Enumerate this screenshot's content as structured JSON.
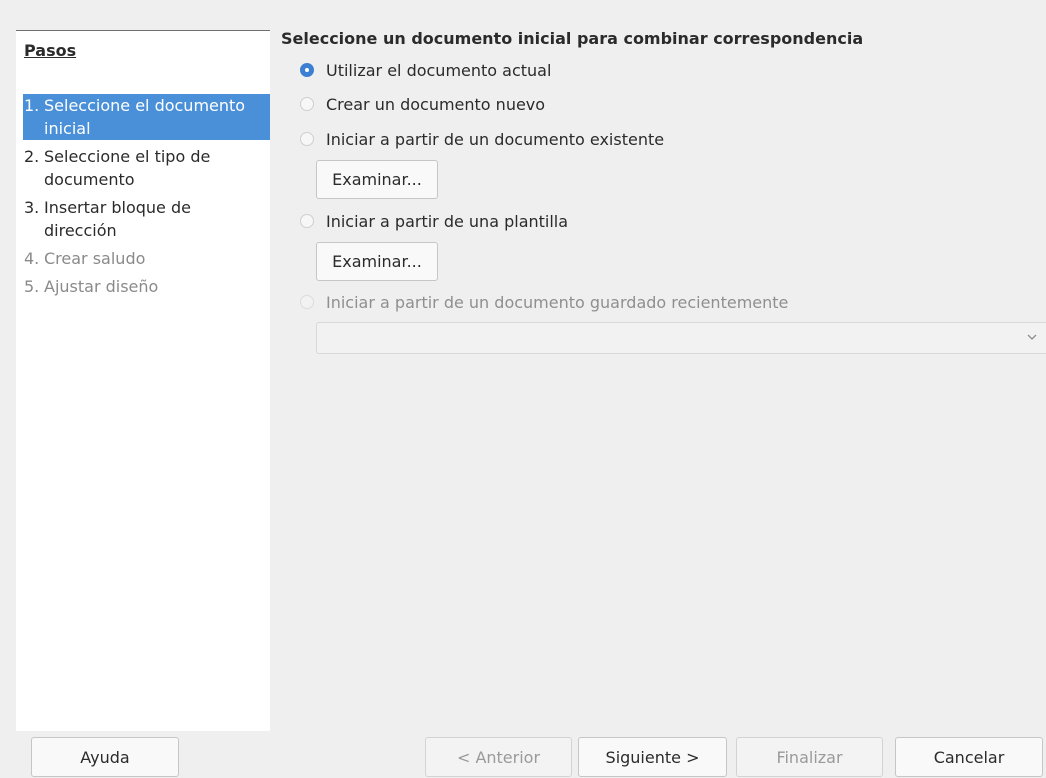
{
  "steps": {
    "title": "Pasos",
    "items": [
      {
        "num": "1.",
        "label": "Seleccione el documento inicial",
        "state": "active"
      },
      {
        "num": "2.",
        "label": "Seleccione el tipo de documento",
        "state": "enabled"
      },
      {
        "num": "3.",
        "label": "Insertar bloque de dirección",
        "state": "enabled"
      },
      {
        "num": "4.",
        "label": "Crear saludo",
        "state": "disabled"
      },
      {
        "num": "5.",
        "label": "Ajustar diseño",
        "state": "disabled"
      }
    ]
  },
  "main": {
    "heading": "Seleccione un documento inicial para combinar correspondencia",
    "options": [
      {
        "label": "Utilizar el documento actual",
        "checked": true,
        "enabled": true
      },
      {
        "label": "Crear un documento nuevo",
        "checked": false,
        "enabled": true
      },
      {
        "label": "Iniciar a partir de un documento existente",
        "checked": false,
        "enabled": true
      },
      {
        "label": "Iniciar a partir de una plantilla",
        "checked": false,
        "enabled": true
      },
      {
        "label": "Iniciar a partir de un documento guardado recientemente",
        "checked": false,
        "enabled": false
      }
    ],
    "browse_label": "Examinar...",
    "recent_combo_value": ""
  },
  "footer": {
    "help": "Ayuda",
    "previous": "< Anterior",
    "next": "Siguiente >",
    "finish": "Finalizar",
    "cancel": "Cancelar"
  },
  "colors": {
    "accent": "#4a90d9",
    "radio_checked": "#3d7fd2",
    "background": "#efefef",
    "disabled_text": "#8a8a8a"
  },
  "icons": {
    "combo_arrow": "chevron-down-icon"
  }
}
